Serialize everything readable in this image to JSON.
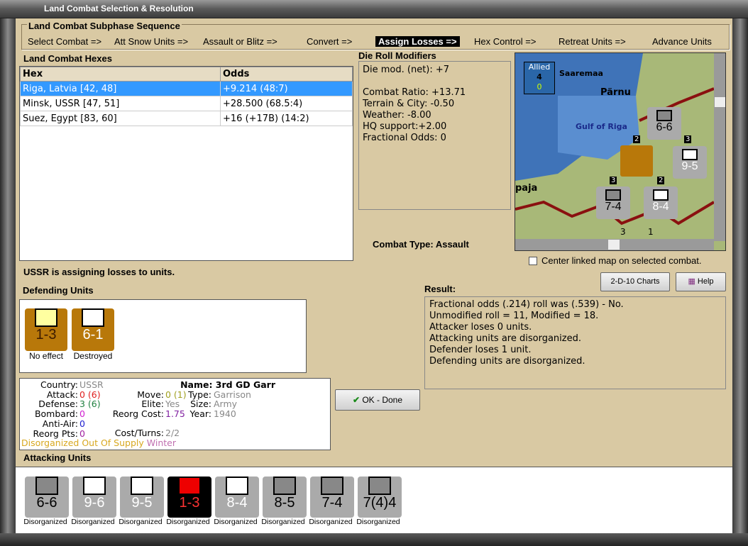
{
  "window": {
    "title": "Land Combat Selection & Resolution"
  },
  "sequence": {
    "title": "Land Combat Subphase Sequence",
    "steps": [
      "Select Combat =>",
      "Att Snow Units =>",
      "Assault or Blitz =>",
      "Convert =>",
      "Assign Losses =>",
      "Hex Control =>",
      "Retreat Units =>",
      "Advance Units"
    ],
    "active": "Assign Losses =>"
  },
  "hexes": {
    "title": "Land Combat Hexes",
    "columns": [
      "Hex",
      "Odds"
    ],
    "rows": [
      [
        "Riga, Latvia [42, 48]",
        "+9.214 (48:7)"
      ],
      [
        "Minsk, USSR [47, 51]",
        "+28.500 (68.5:4)"
      ],
      [
        "Suez, Egypt [83, 60]",
        "+16 (+17B) (14:2)"
      ]
    ]
  },
  "die_roll": {
    "title": "Die Roll Modifiers",
    "lines": [
      "Die mod. (net): +7",
      "",
      "Combat Ratio: +13.71",
      "Terrain & City: -0.50",
      "Weather: -8.00",
      "HQ support:+2.00",
      "Fractional Odds: 0"
    ]
  },
  "combat_type": "Combat Type:  Assault",
  "map": {
    "allied_label": "Allied",
    "allied_num": "4",
    "allied_sub": "0",
    "places": [
      "Saaremaa",
      "Pärnu",
      "Gulf of Riga",
      "paja"
    ],
    "counters": [
      "6-6",
      "9-5",
      "7-4",
      "8-4"
    ],
    "stack_nums": [
      "2",
      "3",
      "3",
      "2"
    ],
    "bottom": [
      "3",
      "1"
    ]
  },
  "center_linked": "Center linked map on selected combat.",
  "status": "USSR is assigning losses to units.",
  "buttons": {
    "charts": "2-D-10 Charts",
    "help": "Help",
    "ok": "OK - Done"
  },
  "defending": {
    "title": "Defending Units",
    "units": [
      {
        "value": "1-3",
        "caption": "No effect"
      },
      {
        "value": "6-1",
        "caption": "Destroyed"
      }
    ]
  },
  "result": {
    "title": "Result:",
    "lines": [
      "Fractional odds (.214) roll was (.539)  - No.",
      "Unmodified roll = 11, Modified = 18.",
      "Attacker loses 0 units.",
      "Attacking units are disorganized.",
      "Defender loses 1 unit.",
      "Defending units are disorganized."
    ]
  },
  "unit_info": {
    "country_label": "Country:",
    "country": "USSR",
    "attack_label": "Attack:",
    "attack": "0 (6)",
    "defense_label": "Defense:",
    "defense": "3 (6)",
    "bombard_label": "Bombard:",
    "bombard": "0",
    "antiair_label": "Anti-Air:",
    "antiair": "0",
    "reorg_pts_label": "Reorg Pts:",
    "reorg_pts": "0",
    "name": "Name: 3rd GD Garr",
    "move_label": "Move:",
    "move": "0 (1)",
    "type_label": "Type:",
    "type": "Garrison",
    "elite_label": "Elite:",
    "elite": "Yes",
    "size_label": "Size:",
    "size": "Army",
    "reorg_cost_label": "Reorg Cost:",
    "reorg_cost": "1.75",
    "year_label": "Year:",
    "year": "1940",
    "cost_turns_label": "Cost/Turns:",
    "cost_turns": "2/2",
    "status1": "Disorganized Out Of Supply",
    "status2": "Winter"
  },
  "attacking": {
    "title": "Attacking Units",
    "units": [
      {
        "value": "6-6",
        "caption": "Disorganized"
      },
      {
        "value": "9-6",
        "caption": "Disorganized"
      },
      {
        "value": "9-5",
        "caption": "Disorganized"
      },
      {
        "value": "1-3",
        "caption": "Disorganized"
      },
      {
        "value": "8-4",
        "caption": "Disorganized"
      },
      {
        "value": "8-5",
        "caption": "Disorganized"
      },
      {
        "value": "7-4",
        "caption": "Disorganized"
      },
      {
        "value": "7(4)4",
        "caption": "Disorganized"
      }
    ]
  },
  "colors": {
    "parchment": "#d9c9a3",
    "selection": "#3399ff",
    "defender": "#b8780a",
    "attacker": "#aaaaaa"
  }
}
